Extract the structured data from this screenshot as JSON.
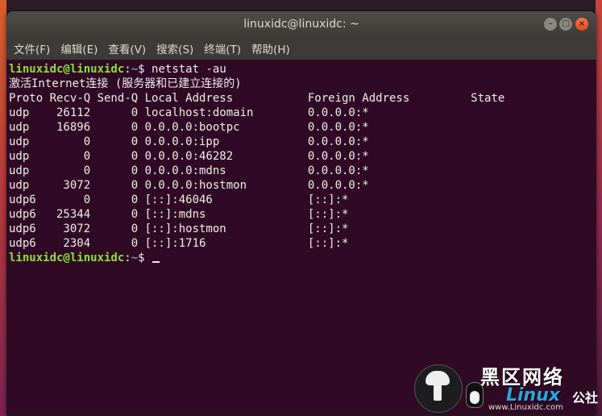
{
  "window": {
    "title": "linuxidc@linuxidc: ~",
    "controls": {
      "minimize": "–",
      "maximize": "□",
      "close": "×"
    }
  },
  "menu": [
    "文件(F)",
    "编辑(E)",
    "查看(V)",
    "搜索(S)",
    "终端(T)",
    "帮助(H)"
  ],
  "terminal": {
    "prompt_user": "linuxidc@linuxidc",
    "prompt_sep": ":",
    "prompt_path": "~",
    "prompt_symbol": "$",
    "command": " netstat -au",
    "header_line": "激活Internet连接 (服务器和已建立连接的)",
    "columns_line": "Proto Recv-Q Send-Q Local Address           Foreign Address         State",
    "rows": [
      "udp    26112      0 localhost:domain        0.0.0.0:*",
      "udp    16896      0 0.0.0.0:bootpc          0.0.0.0:*",
      "udp        0      0 0.0.0.0:ipp             0.0.0.0:*",
      "udp        0      0 0.0.0.0:46282           0.0.0.0:*",
      "udp        0      0 0.0.0.0:mdns            0.0.0.0:*",
      "udp     3072      0 0.0.0.0:hostmon         0.0.0.0:*",
      "udp6       0      0 [::]:46046              [::]:*",
      "udp6   25344      0 [::]:mdns               [::]:*",
      "udp6    3072      0 [::]:hostmon            [::]:*",
      "udp6    2304      0 [::]:1716               [::]:*"
    ]
  },
  "watermark": {
    "line1": "黑区网络",
    "brand": "Linux",
    "brand_suffix": "公社",
    "url": "www.Linuxidc.com"
  },
  "colors": {
    "terminal_bg": "#300a24",
    "prompt_user": "#8ae234",
    "prompt_path": "#729fcf",
    "titlebar": "#3c3b37",
    "close_button": "#e0471e"
  }
}
